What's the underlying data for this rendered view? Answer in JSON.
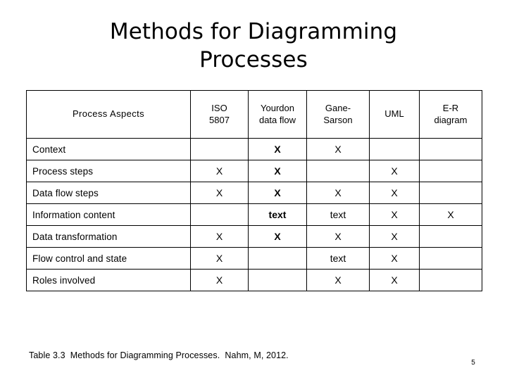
{
  "slide": {
    "title": "Methods for Diagramming\nProcesses",
    "caption": "Table 3.3  Methods for Diagramming Processes.  Nahm, M, 2012.",
    "page_number": "5",
    "background_color": "#ffffff",
    "text_color": "#000000",
    "border_color": "#000000"
  },
  "table": {
    "columns": [
      {
        "key": "aspect",
        "label": "Process Aspects"
      },
      {
        "key": "iso",
        "label": "ISO\n5807"
      },
      {
        "key": "yourdon",
        "label": "Yourdon\ndata flow"
      },
      {
        "key": "gane",
        "label": "Gane-\nSarson"
      },
      {
        "key": "uml",
        "label": "UML"
      },
      {
        "key": "er",
        "label": "E-R\ndiagram"
      }
    ],
    "rows": [
      {
        "label": "Context",
        "cells": [
          "",
          "X",
          "X",
          "",
          ""
        ]
      },
      {
        "label": "Process steps",
        "cells": [
          "X",
          "X",
          "",
          "X",
          ""
        ]
      },
      {
        "label": "Data flow steps",
        "cells": [
          "X",
          "X",
          "X",
          "X",
          ""
        ]
      },
      {
        "label": "Information content",
        "cells": [
          "",
          "text",
          "text",
          "X",
          "X"
        ]
      },
      {
        "label": "Data transformation",
        "cells": [
          "X",
          "X",
          "X",
          "X",
          ""
        ]
      },
      {
        "label": "Flow control and state",
        "cells": [
          "X",
          "",
          "text",
          "X",
          ""
        ]
      },
      {
        "label": "Roles involved",
        "cells": [
          "X",
          "",
          "X",
          "X",
          ""
        ]
      }
    ]
  }
}
